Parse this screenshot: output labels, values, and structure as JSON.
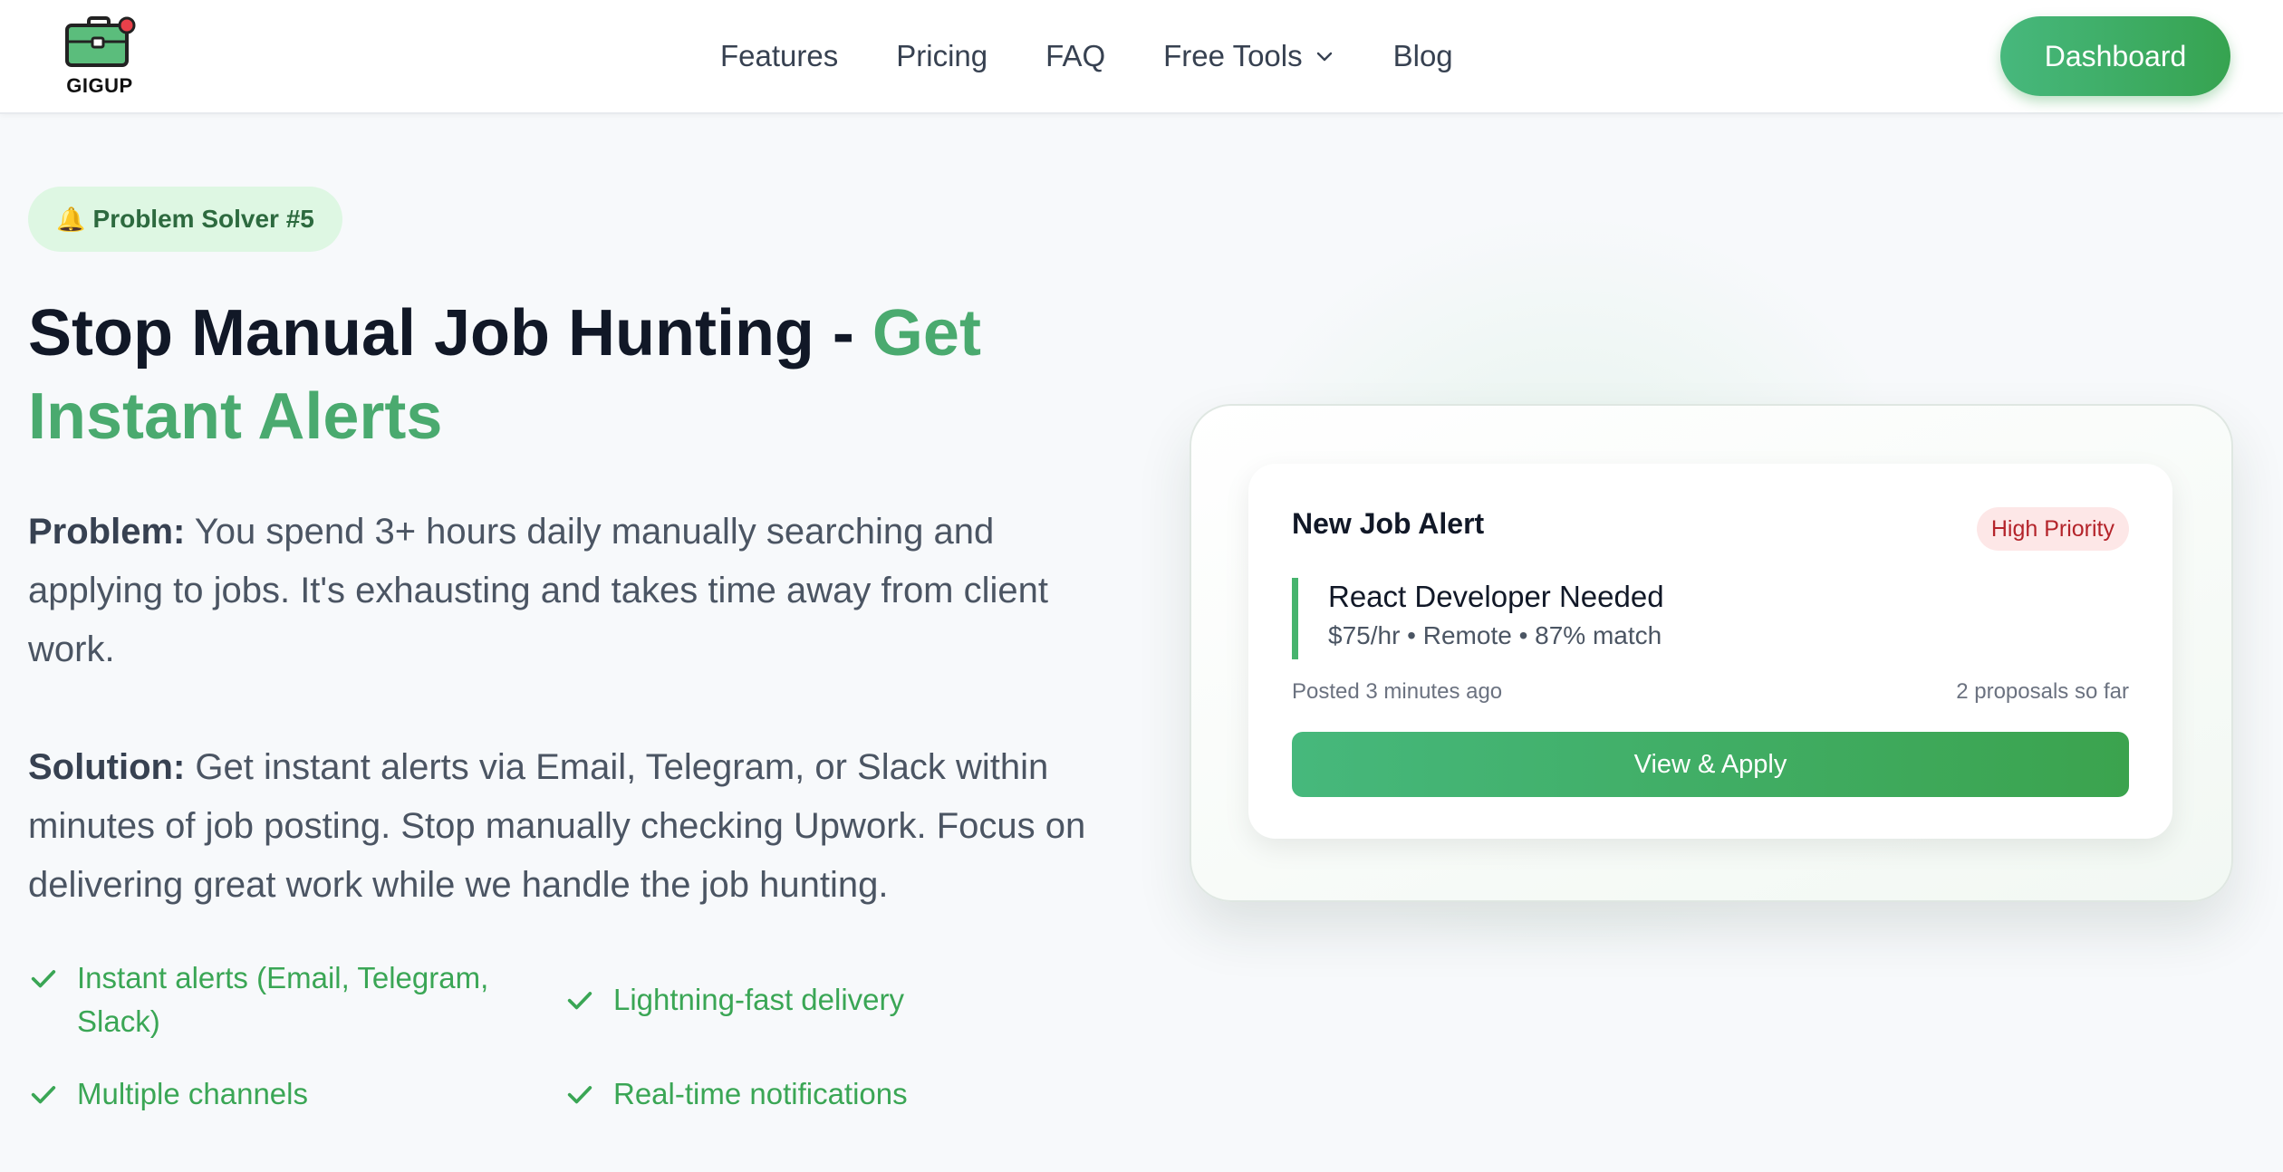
{
  "brand": {
    "name": "GIGUP"
  },
  "nav": {
    "items": [
      {
        "label": "Features"
      },
      {
        "label": "Pricing"
      },
      {
        "label": "FAQ"
      },
      {
        "label": "Free Tools"
      },
      {
        "label": "Blog"
      }
    ],
    "dashboard_label": "Dashboard"
  },
  "hero": {
    "badge": "Problem Solver #5",
    "headline_main": "Stop Manual Job Hunting - ",
    "headline_accent": "Get Instant Alerts",
    "problem_label": "Problem:",
    "problem_text": " You spend 3+ hours daily manually searching and applying to jobs. It's exhausting and takes time away from client work.",
    "solution_label": "Solution:",
    "solution_text": " Get instant alerts via Email, Telegram, or Slack within minutes of job posting. Stop manually checking Upwork. Focus on delivering great work while we handle the job hunting.",
    "features": [
      "Instant alerts (Email, Telegram, Slack)",
      "Lightning-fast delivery",
      "Multiple channels",
      "Real-time notifications"
    ]
  },
  "alert_card": {
    "title": "New Job Alert",
    "priority": "High Priority",
    "job_title": "React Developer Needed",
    "job_meta": "$75/hr • Remote • 87% match",
    "posted": "Posted 3 minutes ago",
    "proposals": "2 proposals so far",
    "button": "View & Apply"
  },
  "colors": {
    "accent_green": "#4aaa6f",
    "button_green": "#3ba34e",
    "priority_red": "#b4232a"
  },
  "icons": [
    "briefcase-icon",
    "chevron-down-icon",
    "bell-icon",
    "check-icon"
  ]
}
